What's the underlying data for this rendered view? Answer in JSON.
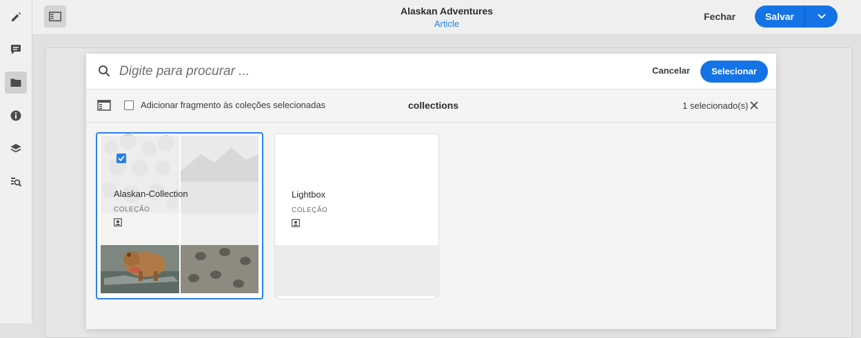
{
  "editor": {
    "title": "Alaskan Adventures",
    "subtitle": "Article",
    "close_label": "Fechar",
    "save_label": "Salvar",
    "rail_icons": [
      "edit-icon",
      "annotation-icon",
      "assets-icon",
      "info-icon",
      "layers-icon",
      "find-asset-icon"
    ],
    "active_rail_item": "assets-icon"
  },
  "picker": {
    "search_placeholder": "Digite para procurar ...",
    "cancel_label": "Cancelar",
    "select_label": "Selecionar",
    "add_to_collections_label": "Adicionar fragmento às coleções selecionadas",
    "add_to_collections_checked": false,
    "context_title": "collections",
    "selection_count": "1 selecionado(s)"
  },
  "cards": [
    {
      "title": "Alaskan-Collection",
      "type": "COLEÇÃO",
      "selected": true,
      "icon": "collection-icon"
    },
    {
      "title": "Lightbox",
      "type": "COLEÇÃO",
      "selected": false,
      "icon": "collection-icon"
    }
  ],
  "colors": {
    "accent": "#1473e6",
    "selection": "#2680eb"
  }
}
